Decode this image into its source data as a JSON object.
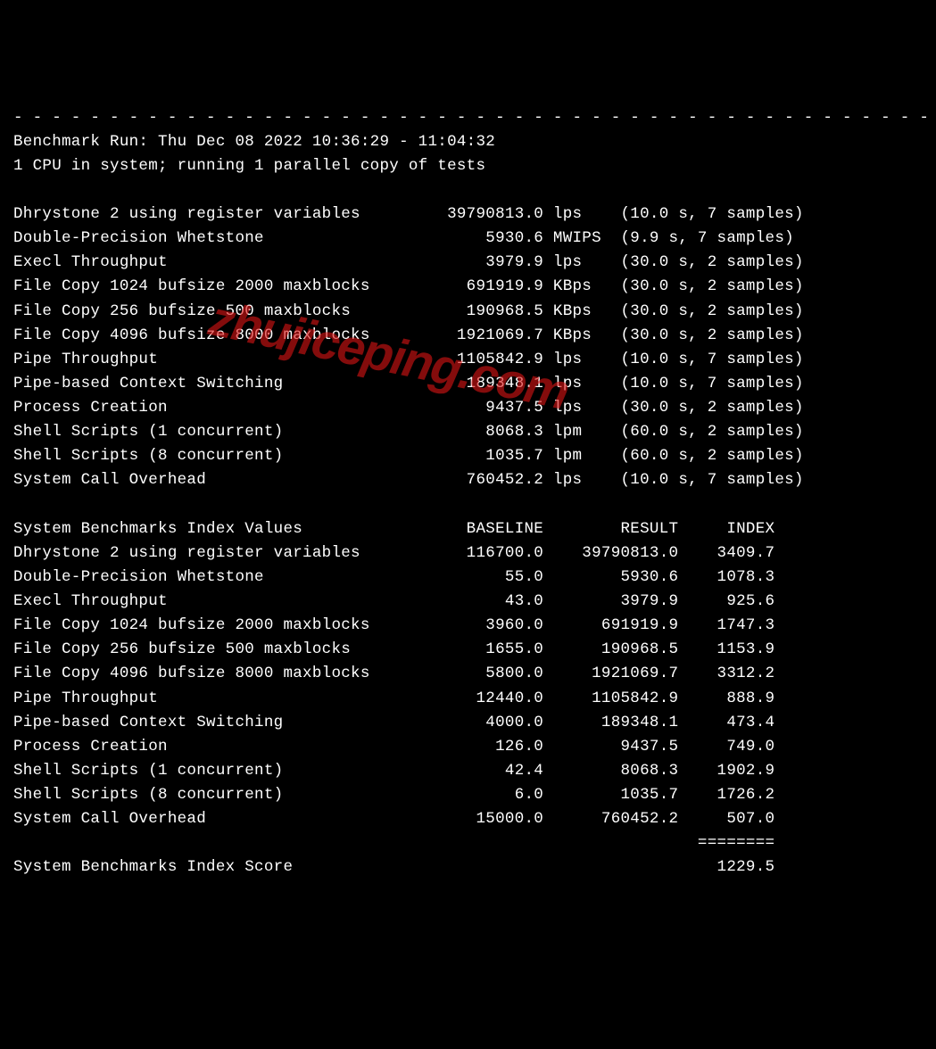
{
  "header": {
    "separator": "- - - - - - - - - - - - - - - - - - - - - - - - - - - - - - - - - - - - - - - - - - - - - - - - -",
    "run_line": "Benchmark Run: Thu Dec 08 2022 10:36:29 - 11:04:32",
    "cpu_line": "1 CPU in system; running 1 parallel copy of tests"
  },
  "tests": [
    {
      "name": "Dhrystone 2 using register variables",
      "value": "39790813.0",
      "unit": "lps",
      "timing": "(10.0 s, 7 samples)"
    },
    {
      "name": "Double-Precision Whetstone",
      "value": "5930.6",
      "unit": "MWIPS",
      "timing": "(9.9 s, 7 samples)"
    },
    {
      "name": "Execl Throughput",
      "value": "3979.9",
      "unit": "lps",
      "timing": "(30.0 s, 2 samples)"
    },
    {
      "name": "File Copy 1024 bufsize 2000 maxblocks",
      "value": "691919.9",
      "unit": "KBps",
      "timing": "(30.0 s, 2 samples)"
    },
    {
      "name": "File Copy 256 bufsize 500 maxblocks",
      "value": "190968.5",
      "unit": "KBps",
      "timing": "(30.0 s, 2 samples)"
    },
    {
      "name": "File Copy 4096 bufsize 8000 maxblocks",
      "value": "1921069.7",
      "unit": "KBps",
      "timing": "(30.0 s, 2 samples)"
    },
    {
      "name": "Pipe Throughput",
      "value": "1105842.9",
      "unit": "lps",
      "timing": "(10.0 s, 7 samples)"
    },
    {
      "name": "Pipe-based Context Switching",
      "value": "189348.1",
      "unit": "lps",
      "timing": "(10.0 s, 7 samples)"
    },
    {
      "name": "Process Creation",
      "value": "9437.5",
      "unit": "lps",
      "timing": "(30.0 s, 2 samples)"
    },
    {
      "name": "Shell Scripts (1 concurrent)",
      "value": "8068.3",
      "unit": "lpm",
      "timing": "(60.0 s, 2 samples)"
    },
    {
      "name": "Shell Scripts (8 concurrent)",
      "value": "1035.7",
      "unit": "lpm",
      "timing": "(60.0 s, 2 samples)"
    },
    {
      "name": "System Call Overhead",
      "value": "760452.2",
      "unit": "lps",
      "timing": "(10.0 s, 7 samples)"
    }
  ],
  "index_header": {
    "title": "System Benchmarks Index Values",
    "col_baseline": "BASELINE",
    "col_result": "RESULT",
    "col_index": "INDEX"
  },
  "index_rows": [
    {
      "name": "Dhrystone 2 using register variables",
      "baseline": "116700.0",
      "result": "39790813.0",
      "index": "3409.7"
    },
    {
      "name": "Double-Precision Whetstone",
      "baseline": "55.0",
      "result": "5930.6",
      "index": "1078.3"
    },
    {
      "name": "Execl Throughput",
      "baseline": "43.0",
      "result": "3979.9",
      "index": "925.6"
    },
    {
      "name": "File Copy 1024 bufsize 2000 maxblocks",
      "baseline": "3960.0",
      "result": "691919.9",
      "index": "1747.3"
    },
    {
      "name": "File Copy 256 bufsize 500 maxblocks",
      "baseline": "1655.0",
      "result": "190968.5",
      "index": "1153.9"
    },
    {
      "name": "File Copy 4096 bufsize 8000 maxblocks",
      "baseline": "5800.0",
      "result": "1921069.7",
      "index": "3312.2"
    },
    {
      "name": "Pipe Throughput",
      "baseline": "12440.0",
      "result": "1105842.9",
      "index": "888.9"
    },
    {
      "name": "Pipe-based Context Switching",
      "baseline": "4000.0",
      "result": "189348.1",
      "index": "473.4"
    },
    {
      "name": "Process Creation",
      "baseline": "126.0",
      "result": "9437.5",
      "index": "749.0"
    },
    {
      "name": "Shell Scripts (1 concurrent)",
      "baseline": "42.4",
      "result": "8068.3",
      "index": "1902.9"
    },
    {
      "name": "Shell Scripts (8 concurrent)",
      "baseline": "6.0",
      "result": "1035.7",
      "index": "1726.2"
    },
    {
      "name": "System Call Overhead",
      "baseline": "15000.0",
      "result": "760452.2",
      "index": "507.0"
    }
  ],
  "index_separator": "========",
  "score": {
    "label": "System Benchmarks Index Score",
    "value": "1229.5"
  },
  "watermark": "zhujiceping.com"
}
